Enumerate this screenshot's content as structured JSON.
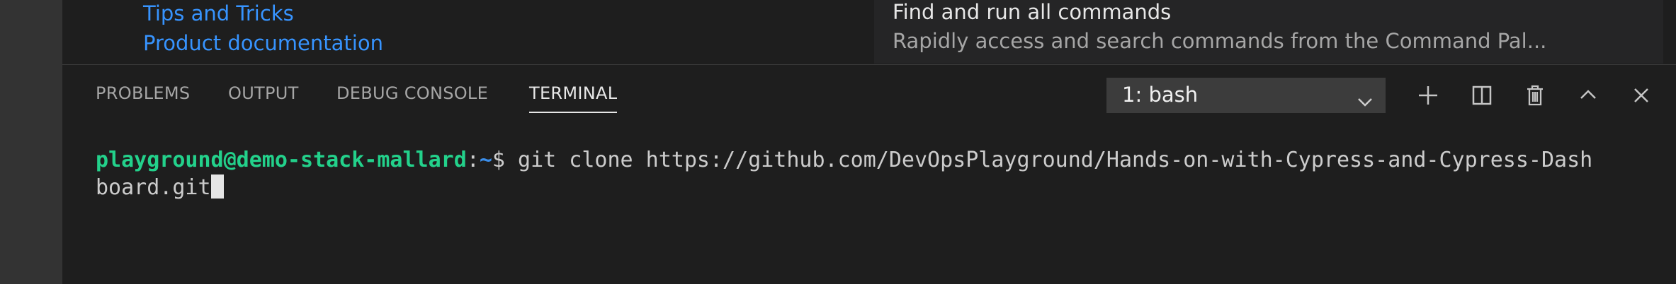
{
  "welcome": {
    "help_links": [
      "Tips and Tricks",
      "Product documentation"
    ],
    "command_card": {
      "title": "Find and run all commands",
      "description": "Rapidly access and search commands from the Command Pal..."
    }
  },
  "panel": {
    "tabs": [
      {
        "label": "PROBLEMS",
        "active": false
      },
      {
        "label": "OUTPUT",
        "active": false
      },
      {
        "label": "DEBUG CONSOLE",
        "active": false
      },
      {
        "label": "TERMINAL",
        "active": true
      }
    ],
    "terminal_select": {
      "value": "1: bash"
    },
    "actions": [
      {
        "icon": "plus-icon",
        "label": "New Terminal"
      },
      {
        "icon": "split-icon",
        "label": "Split Terminal"
      },
      {
        "icon": "trash-icon",
        "label": "Kill Terminal"
      },
      {
        "icon": "chevron-up-icon",
        "label": "Maximize Panel Size"
      },
      {
        "icon": "close-icon",
        "label": "Close Panel"
      }
    ]
  },
  "terminal": {
    "prompt_user_host": "playground@demo-stack-mallard",
    "prompt_sep": ":",
    "prompt_path": "~",
    "prompt_symbol": "$ ",
    "line1_command": "git clone https://github.com/DevOpsPlayground/Hands-on-with-Cypress-and-Cypress-Dash",
    "line2": "board.git"
  },
  "colors": {
    "link": "#3794ff",
    "prompt_user": "#23d18b",
    "prompt_path": "#3b8eea",
    "panel_bg": "#1e1e1e"
  }
}
